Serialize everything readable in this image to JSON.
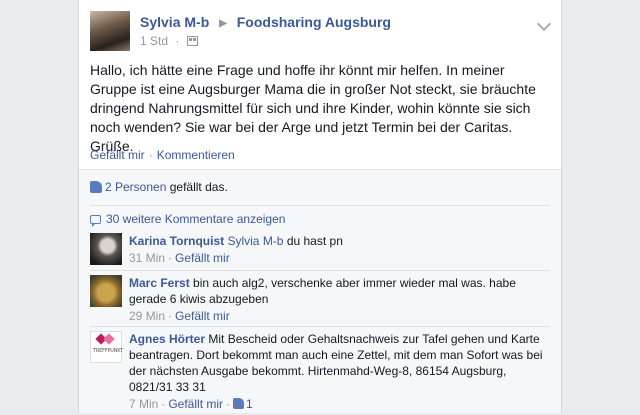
{
  "post": {
    "author": "Sylvia M-b",
    "group": "Foodsharing Augsburg",
    "time": "1 Std",
    "body": "Hallo, ich hätte eine Frage und hoffe ihr könnt mir helfen. In meiner Gruppe ist eine Augsburger Mama die in großer Not steckt, sie bräuchte dringend Nahrungsmittel für sich und ihre Kinder, wohin könnte sie sich noch wenden? Sie war bei der Arge und jetzt Termin bei der Caritas. Grüße.",
    "like_action": "Gefällt mir",
    "comment_action": "Kommentieren"
  },
  "likes": {
    "count_text": "2 Personen",
    "suffix": "gefällt das."
  },
  "more_comments": "30 weitere Kommentare anzeigen",
  "comments": [
    {
      "name": "Karina Tornquist",
      "tag": "Sylvia M-b",
      "text": "du hast pn",
      "time": "31 Min",
      "like_action": "Gefällt mir"
    },
    {
      "name": "Marc Ferst",
      "text": "bin auch alg2, verschenke aber immer wieder mal was. habe gerade 6 kiwis abzugeben",
      "time": "29 Min",
      "like_action": "Gefällt mir"
    },
    {
      "name": "Agnes Hörter",
      "text": "Mit Bescheid oder Gehaltsnachweis zur Tafel gehen und Karte beantragen. Dort bekommt man auch eine Zettel, mit dem man Sofort was bei der nächsten Ausgabe bekommt. Hirtenmahd-Weg-8, 86154 Augsburg, 0821/31 33 31",
      "time": "7 Min",
      "like_action": "Gefällt mir",
      "like_count": "1",
      "avatar_text": "TREFFPUNKT"
    }
  ],
  "colors": {
    "link": "#3b5998",
    "meta": "#9197a3",
    "background": "#e9ebee"
  }
}
